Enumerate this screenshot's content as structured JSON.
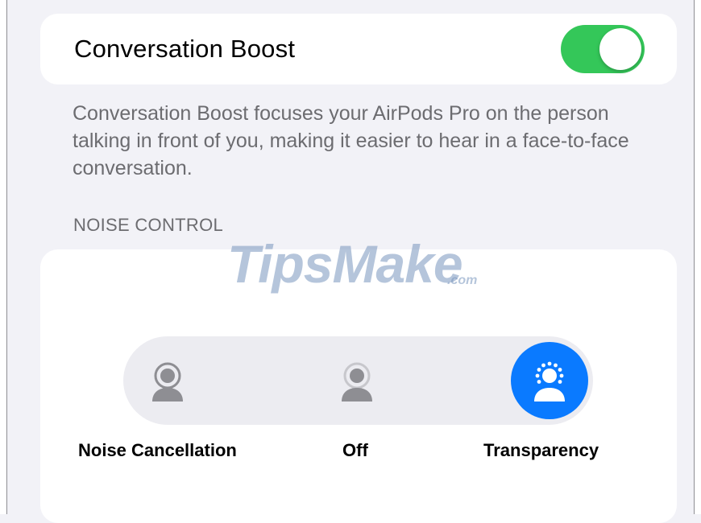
{
  "conversation_boost": {
    "label": "Conversation Boost",
    "enabled": true,
    "description": "Conversation Boost focuses your AirPods Pro on the person talking in front of you, making it easier to hear in a face-to-face conversation."
  },
  "noise_control": {
    "header": "NOISE CONTROL",
    "modes": [
      {
        "label": "Noise Cancellation",
        "icon": "noise-cancellation-icon"
      },
      {
        "label": "Off",
        "icon": "off-icon"
      },
      {
        "label": "Transparency",
        "icon": "transparency-icon"
      }
    ],
    "selected": "Transparency"
  },
  "watermark": {
    "text": "TipsMake",
    "suffix": ".com"
  },
  "colors": {
    "toggle_on": "#34c759",
    "accent": "#0a7aff",
    "background": "#f2f2f7"
  }
}
